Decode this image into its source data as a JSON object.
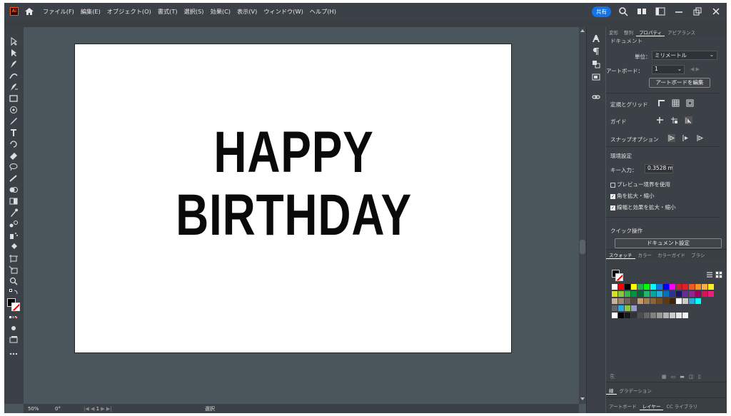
{
  "app": {
    "logo_label": "Ai"
  },
  "menu": [
    "ファイル(F)",
    "編集(E)",
    "オブジェクト(O)",
    "書式(T)",
    "選択(S)",
    "効果(C)",
    "表示(V)",
    "ウィンドウ(W)",
    "ヘルプ(H)"
  ],
  "topright": {
    "share_label": "共有"
  },
  "artboard": {
    "line1": "HAPPY",
    "line2": "BIRTHDAY"
  },
  "status": {
    "zoom": "50%",
    "rotation": "0°",
    "artboard_num": "1",
    "mode": "選択"
  },
  "props": {
    "tabs": [
      "変形",
      "整列",
      "プロパティ",
      "アピアランス"
    ],
    "active_tab": 2,
    "section_doc": "ドキュメント",
    "unit_label": "単位：",
    "unit_value": "ミリメートル",
    "artboard_label": "アートボード：",
    "artboard_value": "1",
    "edit_artboard_btn": "アートボードを編集",
    "ruler_grid": "定規とグリッド",
    "guide": "ガイド",
    "snap": "スナップオプション",
    "prefs": "環境設定",
    "key_input_label": "キー入力：",
    "key_input_value": "0.3528 m",
    "preview_bounds": "プレビュー境界を使用",
    "scale_corners": "角を拡大・縮小",
    "scale_strokes": "線幅と効果を拡大・縮小",
    "checks": [
      false,
      true,
      true
    ],
    "quick_actions": "クイック操作",
    "doc_settings_btn": "ドキュメント設定"
  },
  "swatches": {
    "tabs": [
      "スウォッチ",
      "カラー",
      "カラーガイド",
      "ブラシ"
    ]
  },
  "gradient_panel": {
    "tabs": [
      "線",
      "グラデーション"
    ]
  },
  "layers_panel": {
    "tabs": [
      "アートボード",
      "レイヤー",
      "CC ライブラリ"
    ]
  },
  "colors": {
    "swatch_row1": [
      "#ffffff",
      "#ff0000",
      "#000000",
      "#ffff00",
      "#22b14c",
      "#00ff00",
      "#00ffff",
      "#1473e6",
      "#0000ff",
      "#ff00ff",
      "#c1272d",
      "#ed1c24",
      "#f15a24",
      "#f7931e",
      "#fbb03b",
      "#fcee21"
    ],
    "swatch_row2": [
      "#d9e021",
      "#8cc63f",
      "#39b54a",
      "#009245",
      "#006837",
      "#22b573",
      "#00a99d",
      "#29abe2",
      "#0071bc",
      "#2e3192",
      "#1b1464",
      "#662d91",
      "#93278f",
      "#9e005d",
      "#d4145a",
      "#ed1e79"
    ],
    "swatch_row3": [
      "#c7b299",
      "#998675",
      "#736357",
      "#534741",
      "#c69c6d",
      "#a67c52",
      "#8c6239",
      "#754c24",
      "#603813",
      "#42210b",
      "#ffffff",
      "#cccccc",
      "#29abe2",
      "#00ffff"
    ],
    "swatch_row4": [
      "#666666",
      "#29abe2",
      "#8cc63f",
      "#9999cc"
    ],
    "swatch_row5": [
      "#ffffff",
      "#000000",
      "#1a1a1a",
      "#333333",
      "#4d4d4d",
      "#666666",
      "#808080",
      "#999999",
      "#b3b3b3",
      "#cccccc",
      "#e6e6e6",
      "#f2f2f2"
    ]
  }
}
